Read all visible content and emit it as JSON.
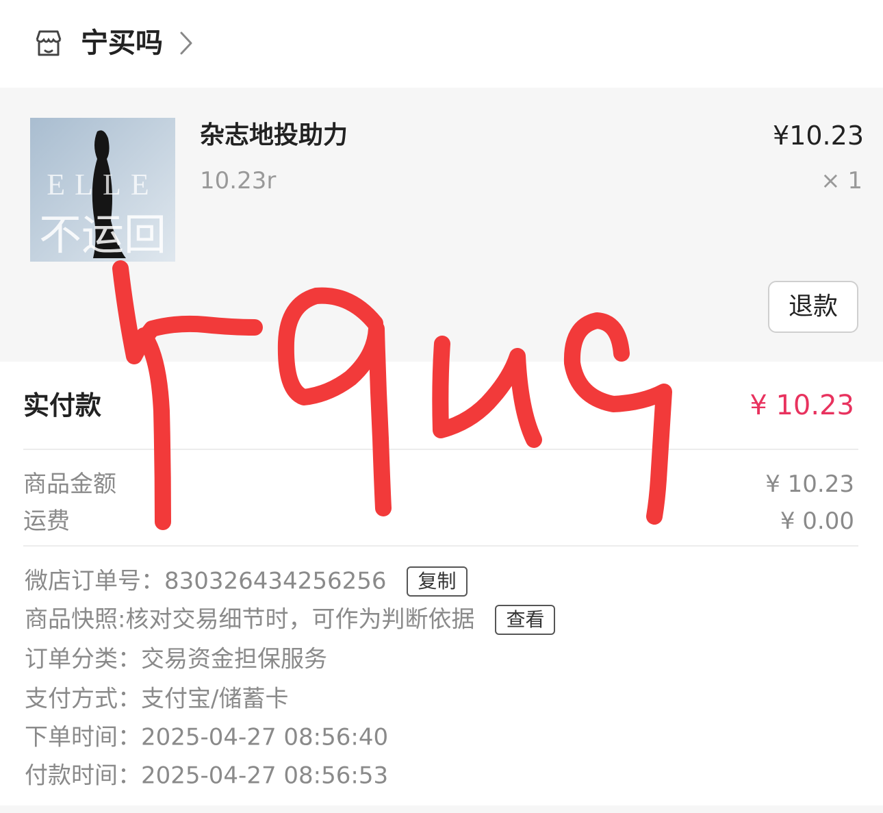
{
  "header": {
    "icon": "store-icon",
    "shop_name": "宁买吗",
    "chevron": "chevron-right-icon"
  },
  "product": {
    "thumbnail_text": "不运回",
    "thumbnail_brand": "ELLE",
    "title": "杂志地投助力",
    "spec": "10.23r",
    "price": "¥10.23",
    "quantity": "× 1",
    "refund_label": "退款"
  },
  "payment": {
    "paid_label": "实付款",
    "paid_value": "¥ 10.23",
    "goods_amount_label": "商品金额",
    "goods_amount_value": "¥ 10.23",
    "shipping_label": "运费",
    "shipping_value": "¥ 0.00"
  },
  "order_info": {
    "order_no_label": "微店订单号：",
    "order_no_value": "830326434256256",
    "copy_label": "复制",
    "snapshot_label": "商品快照:",
    "snapshot_value": "核对交易细节时，可作为判断依据",
    "view_label": "查看",
    "category_label": "订单分类：",
    "category_value": "交易资金担保服务",
    "payment_method_label": "支付方式：",
    "payment_method_value": "支付宝/储蓄卡",
    "order_time_label": "下单时间：",
    "order_time_value": "2025-04-27 08:56:40",
    "pay_time_label": "付款时间：",
    "pay_time_value": "2025-04-27 08:56:53"
  },
  "colors": {
    "accent_price": "#e8325e",
    "scribble": "#f23a3a",
    "section_bg": "#f6f6f6"
  }
}
